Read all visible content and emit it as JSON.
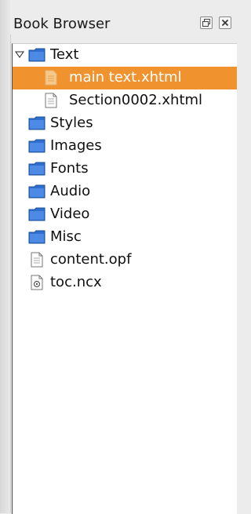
{
  "panel": {
    "title": "Book Browser"
  },
  "tree": {
    "items": [
      {
        "label": "Text",
        "type": "folder",
        "expanded": true
      },
      {
        "label": "main text.xhtml",
        "type": "file",
        "selected": true
      },
      {
        "label": "Section0002.xhtml",
        "type": "file"
      },
      {
        "label": "Styles",
        "type": "folder"
      },
      {
        "label": "Images",
        "type": "folder"
      },
      {
        "label": "Fonts",
        "type": "folder"
      },
      {
        "label": "Audio",
        "type": "folder"
      },
      {
        "label": "Video",
        "type": "folder"
      },
      {
        "label": "Misc",
        "type": "folder"
      },
      {
        "label": "content.opf",
        "type": "file"
      },
      {
        "label": "toc.ncx",
        "type": "toc"
      }
    ]
  },
  "colors": {
    "selection": "#f0922e",
    "folder": "#2f6fd0"
  },
  "icons": {
    "float": "float-icon",
    "close": "close-icon",
    "folder": "folder-icon",
    "file": "document-icon",
    "toc": "toc-file-icon",
    "expander": "expand-arrow-icon"
  }
}
